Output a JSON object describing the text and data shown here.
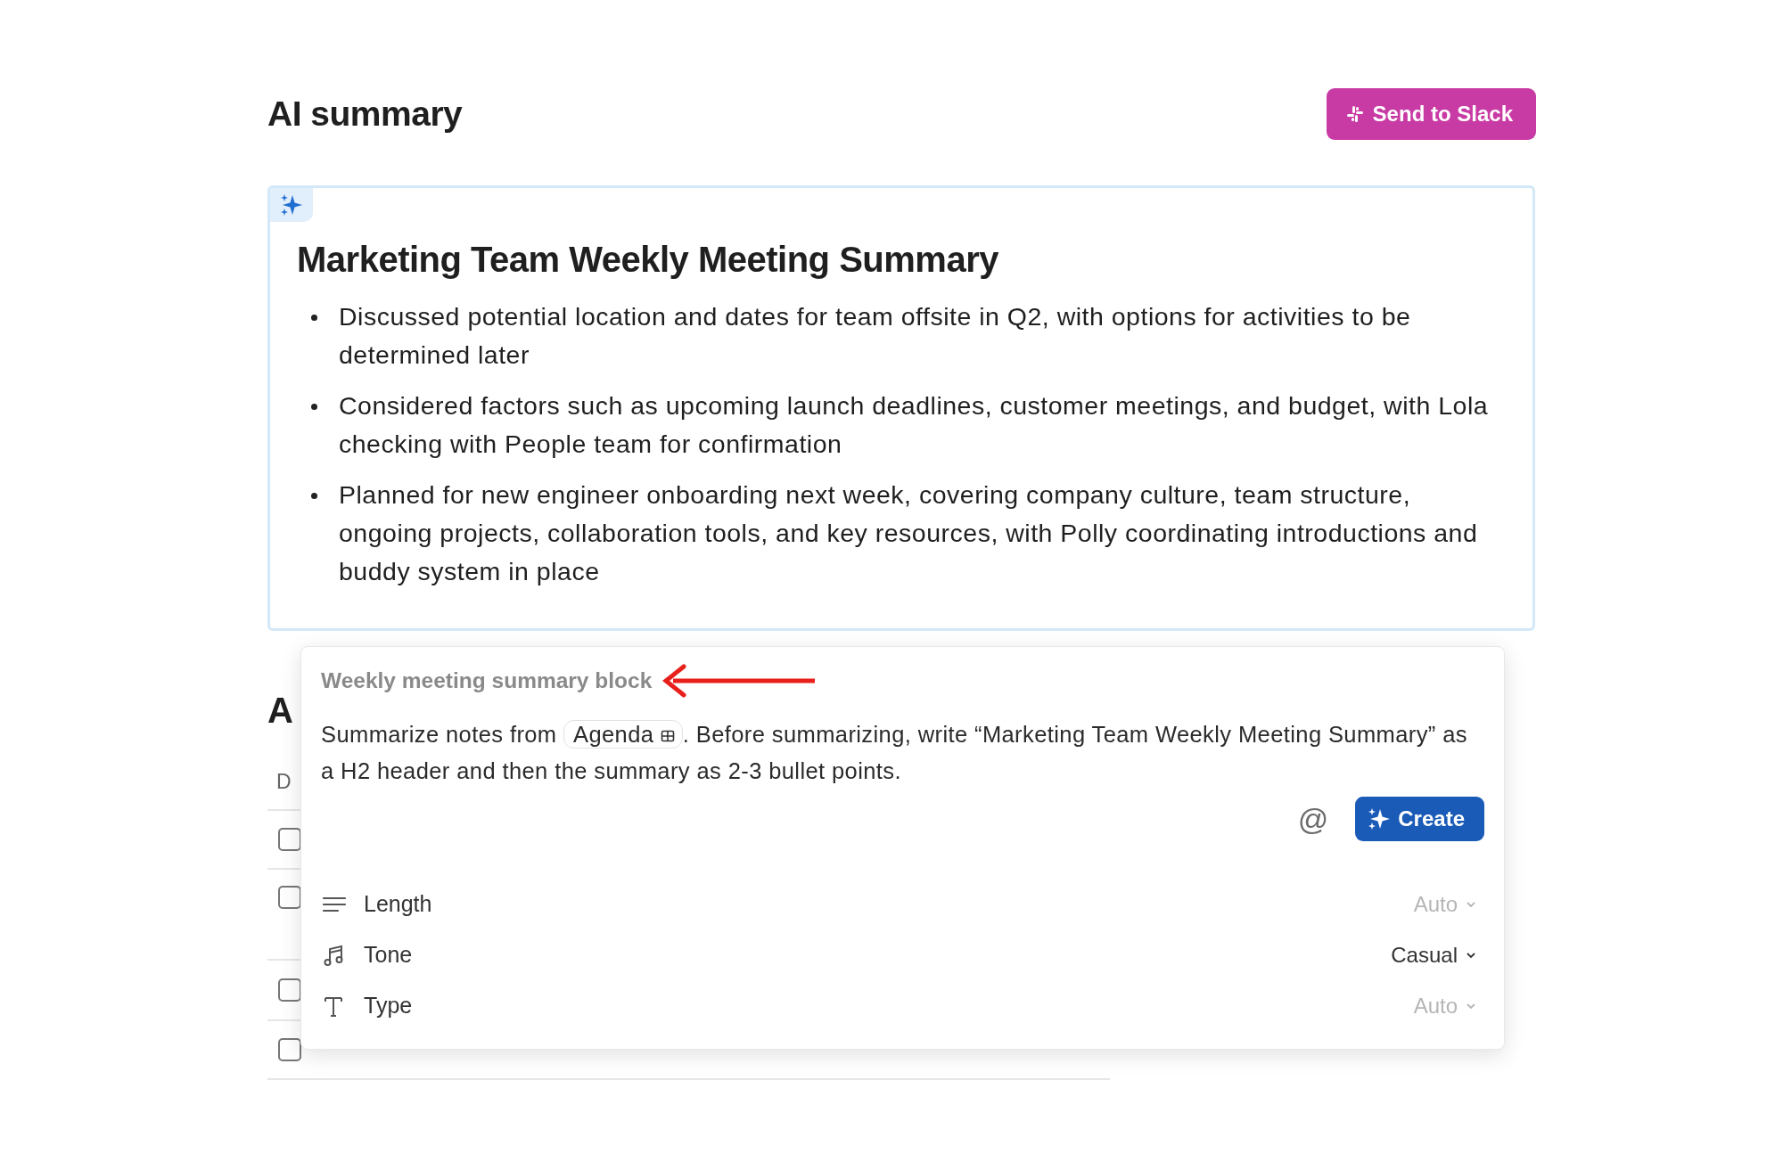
{
  "page": {
    "title": "AI summary",
    "send_button": "Send to Slack"
  },
  "summary": {
    "heading": "Marketing Team Weekly Meeting Summary",
    "bullets": [
      "Discussed potential location and dates for team offsite in Q2, with options for activities to be determined later",
      "Considered factors such as upcoming launch deadlines, customer meetings, and budget, with Lola checking with People team for confirmation",
      "Planned for new engineer onboarding next week, covering company culture, team structure, ongoing projects, collaboration tools, and key resources, with Polly coordinating introductions and buddy system in place"
    ]
  },
  "background_table": {
    "heading": "A",
    "column_1": "D",
    "rows": [
      {
        "checked": false
      },
      {
        "checked": false
      },
      {
        "checked": false
      },
      {
        "checked": false
      }
    ]
  },
  "prompt_popup": {
    "label": "Weekly meeting summary block",
    "text_before": "Summarize notes from",
    "mention": "Agenda",
    "text_after": ". Before summarizing, write “Marketing Team Weekly Meeting Summary” as a H2 header and then the summary as 2-3 bullet points.",
    "at_symbol": "@",
    "create_button": "Create",
    "options": [
      {
        "kind": "length",
        "label": "Length",
        "value": "Auto",
        "default": true
      },
      {
        "kind": "tone",
        "label": "Tone",
        "value": "Casual",
        "default": false
      },
      {
        "kind": "type",
        "label": "Type",
        "value": "Auto",
        "default": true
      }
    ]
  }
}
